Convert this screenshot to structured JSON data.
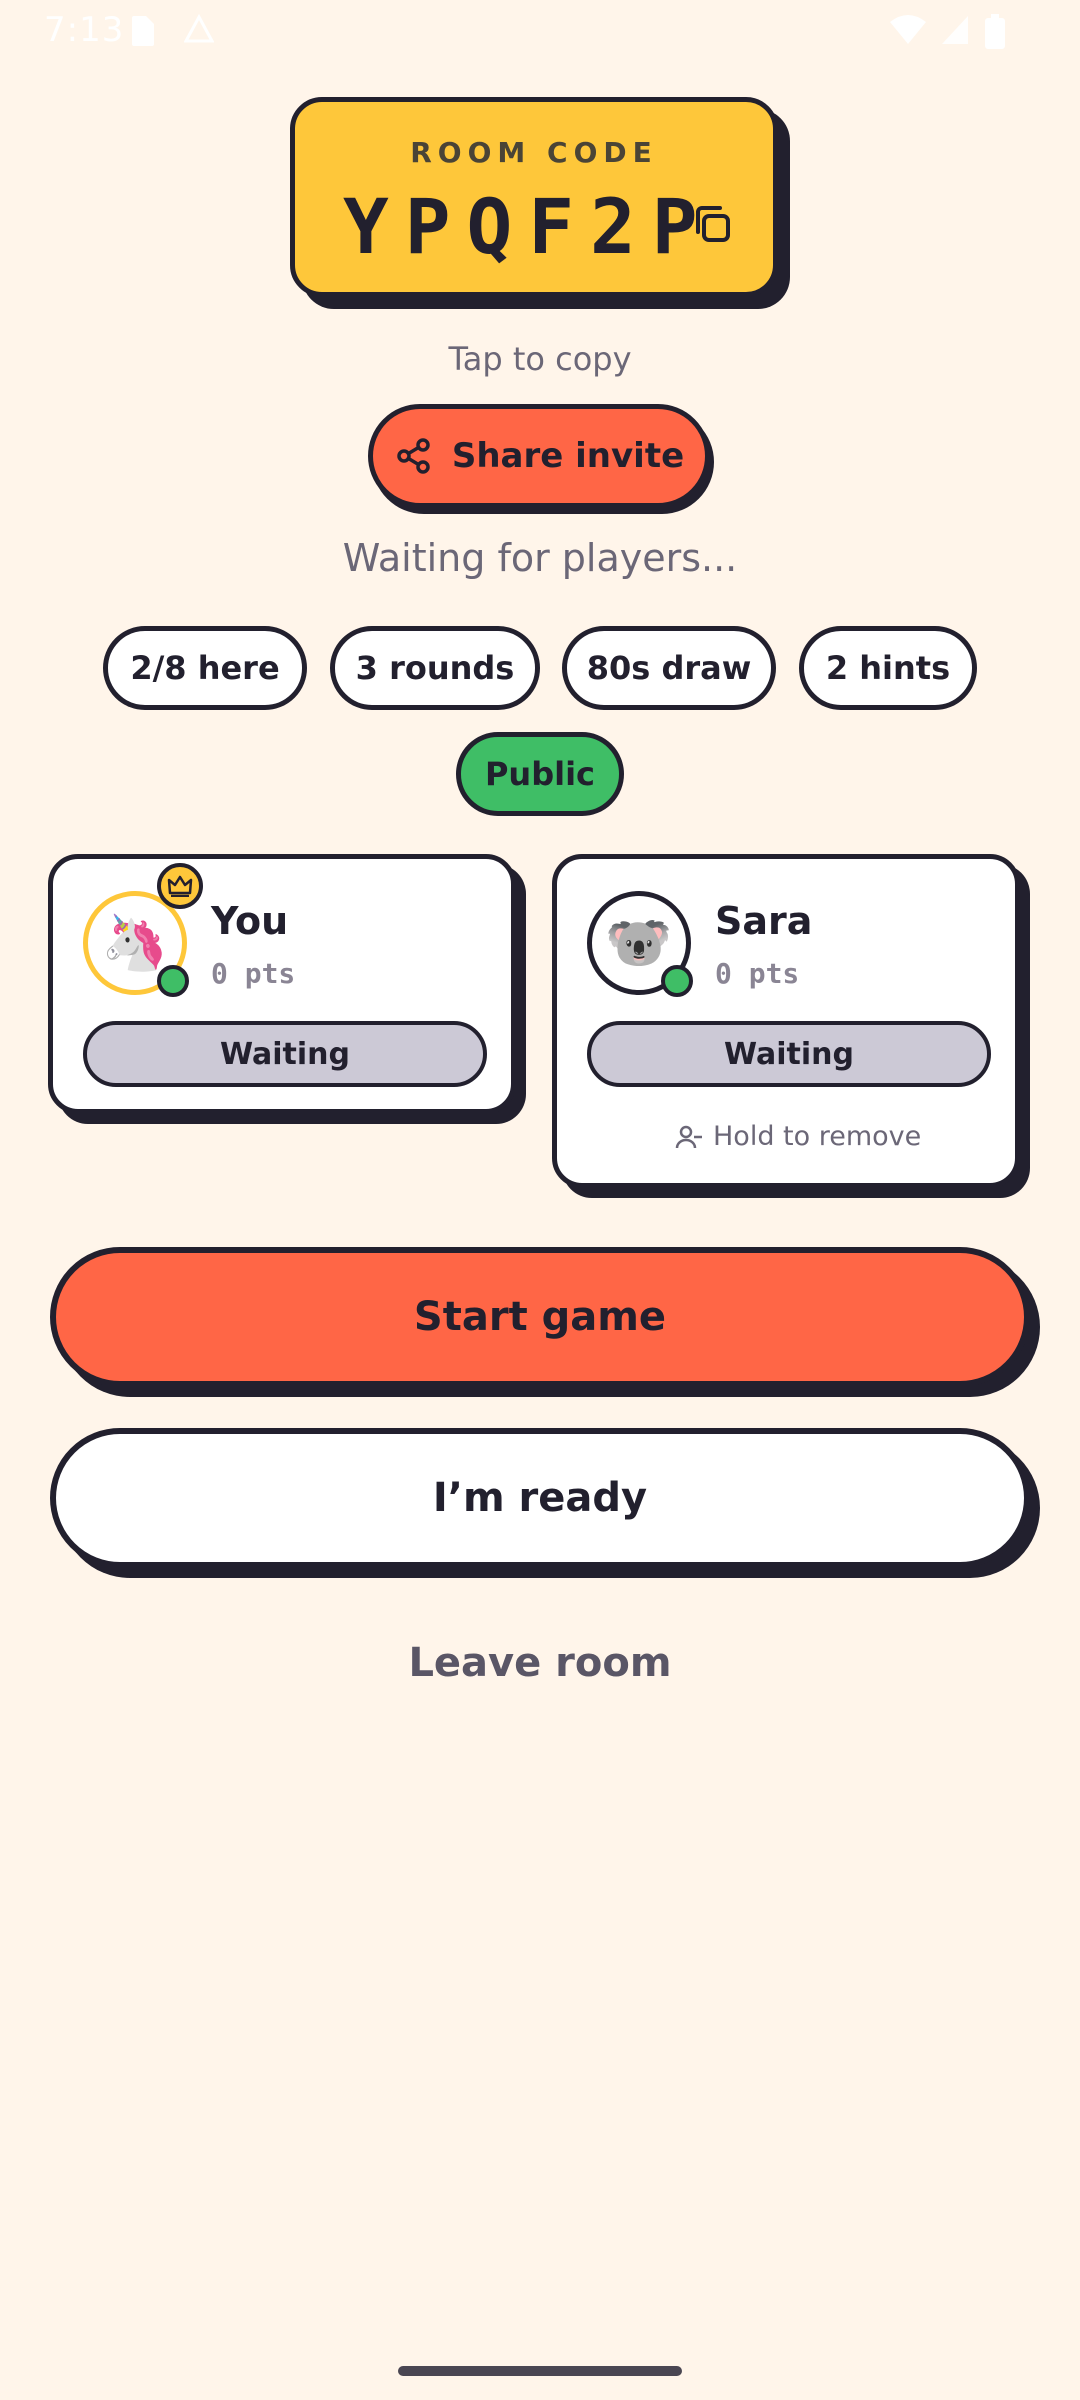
{
  "status_bar": {
    "time": "7:13"
  },
  "room": {
    "label": "ROOM CODE",
    "code": "YPQF2P",
    "tap_hint": "Tap to copy"
  },
  "share": {
    "label": "Share invite"
  },
  "lobby": {
    "waiting_text": "Waiting for players..."
  },
  "chips": [
    {
      "label": "2/8 here"
    },
    {
      "label": "3 rounds"
    },
    {
      "label": "80s draw"
    },
    {
      "label": "2 hints"
    },
    {
      "label": "Public"
    }
  ],
  "players": [
    {
      "name": "You",
      "points": "0 pts",
      "status": "Waiting",
      "avatar_icon": "unicorn-icon",
      "avatar_glyph": "🦄",
      "is_host": true
    },
    {
      "name": "Sara",
      "points": "0 pts",
      "status": "Waiting",
      "avatar_icon": "koala-icon",
      "avatar_glyph": "🐨",
      "remove_hint": "Hold to remove"
    }
  ],
  "actions": {
    "start_label": "Start game",
    "ready_label": "I’m ready",
    "leave_label": "Leave room"
  },
  "colors": {
    "background": "#FFF5EA",
    "room_card": "#FEC73A",
    "primary": "#FF6646",
    "online": "#3FBE66",
    "status_pill": "#CCC9D6",
    "ink": "#22202E"
  }
}
